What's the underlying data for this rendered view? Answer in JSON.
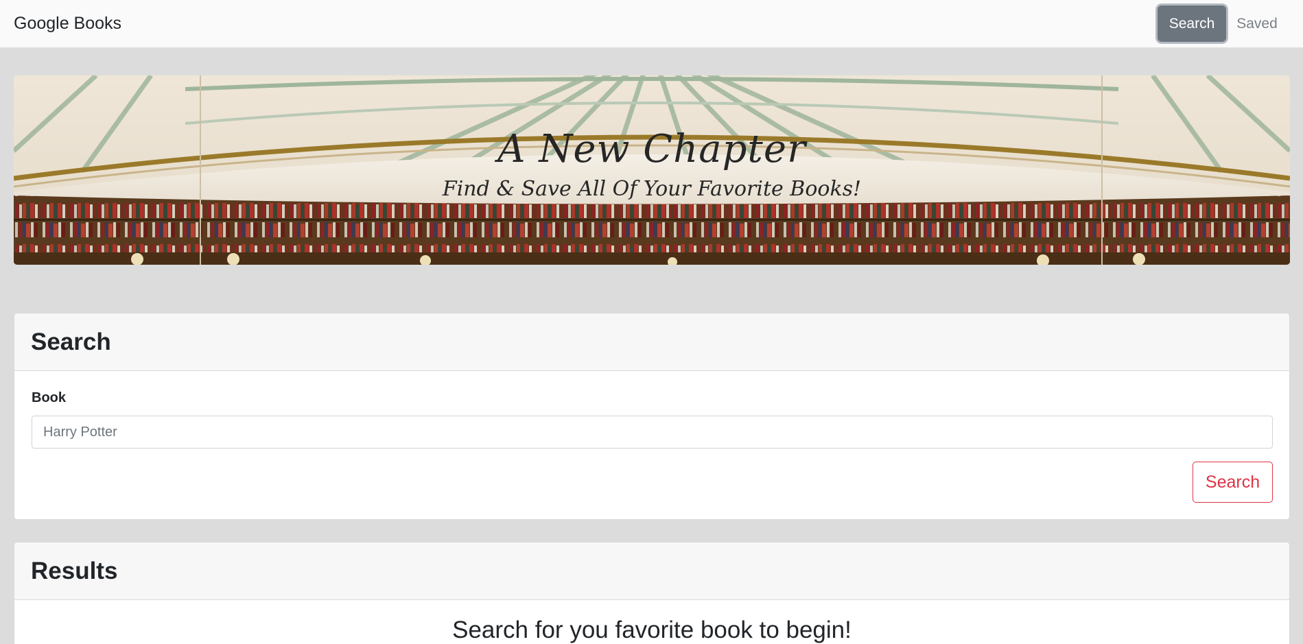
{
  "navbar": {
    "brand": "Google Books",
    "search_label": "Search",
    "saved_label": "Saved"
  },
  "hero": {
    "title": "A New Chapter",
    "subtitle": "Find & Save All Of Your Favorite Books!"
  },
  "search_card": {
    "header": "Search",
    "field_label": "Book",
    "input_placeholder": "Harry Potter",
    "input_value": "",
    "submit_label": "Search",
    "submit_color": "#dc3545"
  },
  "results_card": {
    "header": "Results",
    "empty_message": "Search for you favorite book to begin!"
  },
  "colors": {
    "page_bg": "#dcdcdc",
    "active_nav": "#6c757d"
  }
}
